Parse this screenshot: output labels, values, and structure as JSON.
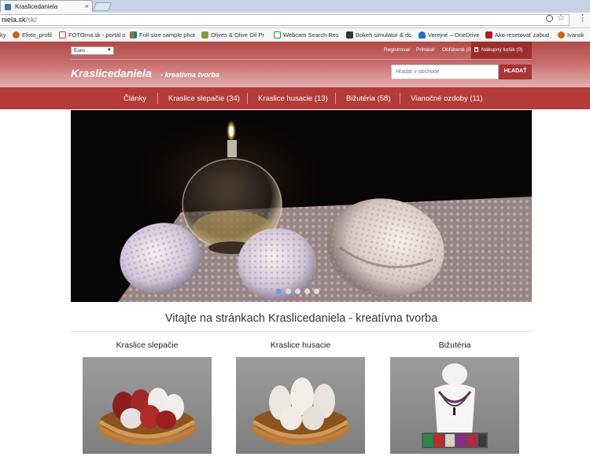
{
  "browser": {
    "tab_title": "Kraslicedaniela",
    "url_host": "niela.sk",
    "url_path": "/sk/",
    "bookmarks": [
      "ky",
      "Efoto_profil",
      "FOTOma.sk - portál o",
      "Full-size sample phot",
      "Olives & Olive Oil Pr",
      "Webcam Search Res",
      "Bokeh simulator & dc",
      "Verejné – OneDrive",
      "Ako resetovať zabud",
      "Ivansk"
    ]
  },
  "header": {
    "currency": "Euro",
    "links": [
      "Registrovať",
      "Prihlásiť",
      "Obľúbené (0)"
    ],
    "cart_label": "Nákupný košík (0)",
    "brand": "Kraslicedaniela",
    "tagline": "- kreatívna tvorba",
    "search_placeholder": "Hľadať v obchode",
    "search_button": "HĽADAŤ"
  },
  "nav": {
    "items": [
      "Články",
      "Kraslice slepačie (34)",
      "Kraslice husacie (13)",
      "Bižutéria (58)",
      "Vianočné ozdoby (11)"
    ]
  },
  "slider": {
    "slide_count": 5,
    "active_index": 0
  },
  "welcome": "Vitajte na stránkach Kraslicedaniela - kreatívna tvorba",
  "categories": [
    "Kraslice slepačie",
    "Kraslice husacie",
    "Bižutéria"
  ],
  "colors": {
    "accent": "#b53a3a",
    "header_top": "#b44a4a",
    "cart": "#9e2e2e",
    "slider_active_dot": "#6aa0d8"
  }
}
